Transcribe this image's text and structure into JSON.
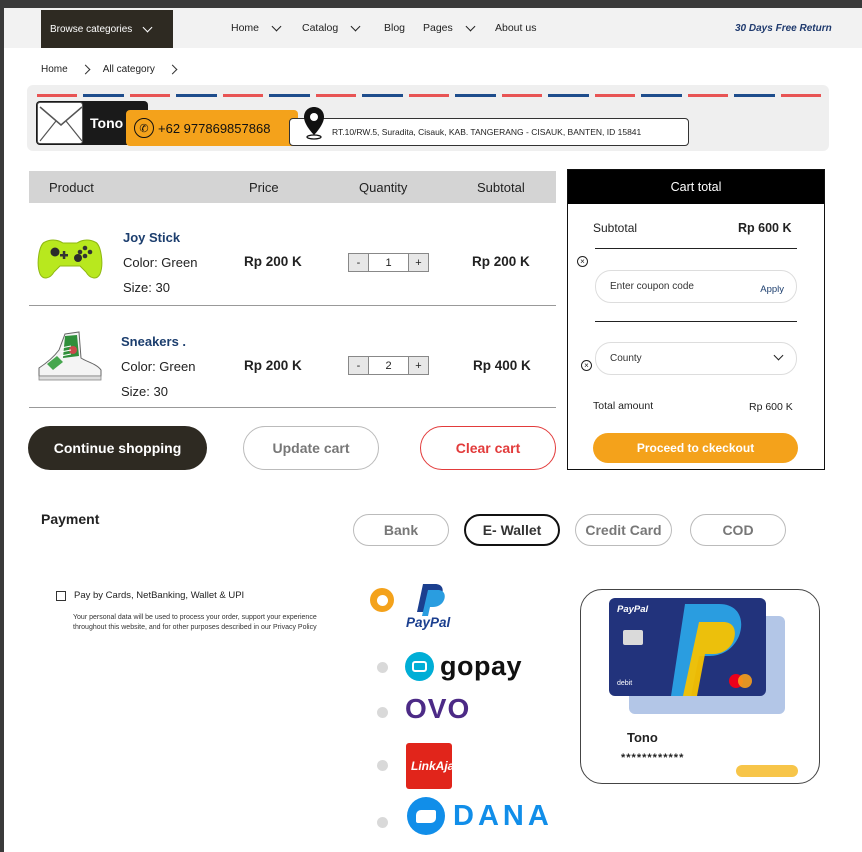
{
  "nav": {
    "browse_label": "Browse categories",
    "items": [
      {
        "label": "Home",
        "has_dropdown": true
      },
      {
        "label": "Catalog",
        "has_dropdown": true
      },
      {
        "label": "Blog",
        "has_dropdown": false
      },
      {
        "label": "Pages",
        "has_dropdown": true
      },
      {
        "label": "About us",
        "has_dropdown": false
      }
    ],
    "promo": "30 Days Free Return"
  },
  "breadcrumb": {
    "items": [
      "Home",
      "All category"
    ]
  },
  "contact": {
    "name": "Tono",
    "phone": "+62 977869857868",
    "address": "RT.10/RW.5, Suradita, Cisauk, KAB. TANGERANG - CISAUK, BANTEN, ID 15841",
    "stripe_colors": [
      "#e85454",
      "#1e4d8c"
    ]
  },
  "table": {
    "headers": {
      "product": "Product",
      "price": "Price",
      "quantity": "Quantity",
      "subtotal": "Subtotal"
    },
    "rows": [
      {
        "name": "Joy Stick",
        "color": "Color: Green",
        "size": "Size: 30",
        "price": "Rp 200 K",
        "qty": "1",
        "minus": "-",
        "plus": "+",
        "subtotal": "Rp 200 K",
        "icon": "controller-image"
      },
      {
        "name": "Sneakers .",
        "color": "Color: Green",
        "size": "Size: 30",
        "price": "Rp 200 K",
        "qty": "2",
        "minus": "-",
        "plus": "+",
        "subtotal": "Rp 400 K",
        "icon": "sneaker-image"
      }
    ]
  },
  "actions": {
    "continue": "Continue shopping",
    "update": "Update cart",
    "clear": "Clear cart"
  },
  "cart_total": {
    "title": "Cart total",
    "subtotal_label": "Subtotal",
    "subtotal_value": "Rp 600 K",
    "coupon_placeholder": "Enter coupon code",
    "apply": "Apply",
    "county_label": "County",
    "total_label": "Total amount",
    "total_value": "Rp 600 K",
    "checkout": "Proceed to ckeckout"
  },
  "payment": {
    "title": "Payment",
    "tabs": [
      {
        "label": "Bank",
        "active": false
      },
      {
        "label": "E- Wallet",
        "active": true
      },
      {
        "label": "Credit Card",
        "active": false
      },
      {
        "label": "COD",
        "active": false
      }
    ],
    "checkbox_label": "Pay by Cards, NetBanking, Wallet & UPI",
    "consent": "Your personal data will be used to process your order, support your experience throughout this website, and for other purposes described in our Privacy Policy",
    "wallets": [
      {
        "name": "PayPal",
        "selected": true
      },
      {
        "name": "gopay",
        "selected": false
      },
      {
        "name": "OVO",
        "selected": false
      },
      {
        "name": "LinkAja!",
        "selected": false
      },
      {
        "name": "DANA",
        "selected": false
      }
    ]
  },
  "card": {
    "brand": "PayPal",
    "type": "debit",
    "holder": "Tono",
    "number_mask": "************"
  },
  "colors": {
    "accent": "#f4a21b",
    "dark": "#2e2a22",
    "navy": "#1c3e6e",
    "danger": "#e23b3b"
  }
}
